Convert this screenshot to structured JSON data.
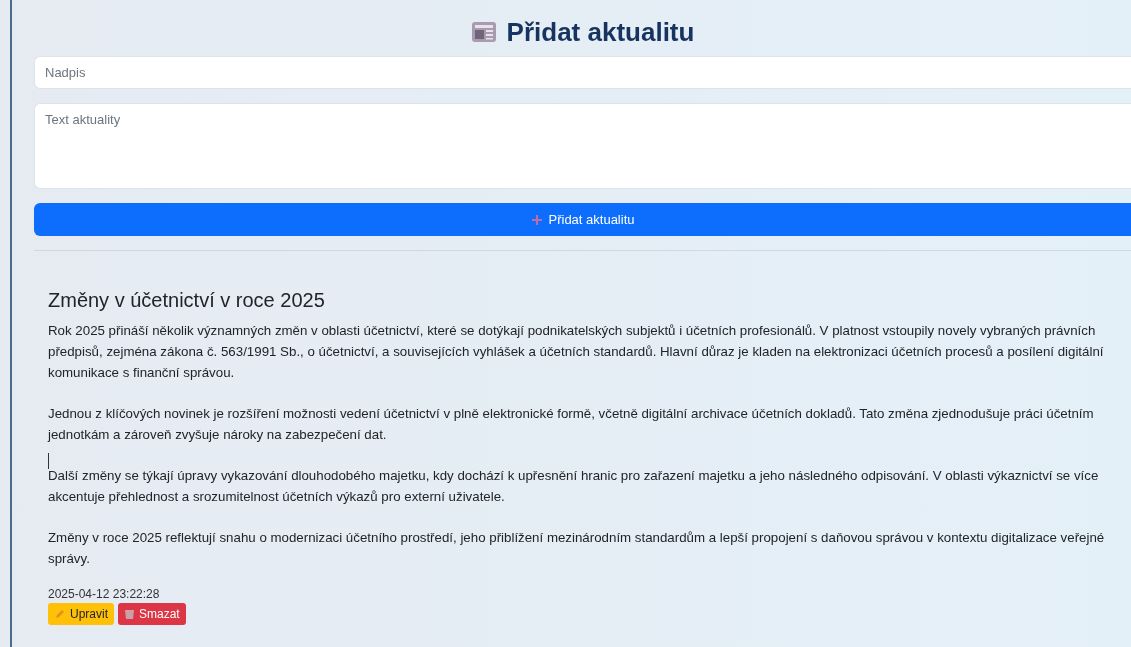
{
  "heading": "Přidat aktualitu",
  "form": {
    "title_placeholder": "Nadpis",
    "text_placeholder": "Text aktuality",
    "submit_label": "Přidat aktualitu"
  },
  "news": [
    {
      "title": "Změny v účetnictví v roce 2025",
      "paragraphs": [
        "Rok 2025 přináší několik významných změn v oblasti účetnictví, které se dotýkají podnikatelských subjektů i účetních profesionálů. V platnost vstoupily novely vybraných právních předpisů, zejména zákona č. 563/1991 Sb., o účetnictví, a souvisejících vyhlášek a účetních standardů. Hlavní důraz je kladen na elektronizaci účetních procesů a posílení digitální komunikace s finanční správou.",
        "Jednou z klíčových novinek je rozšíření možnosti vedení účetnictví v plně elektronické formě, včetně digitální archivace účetních dokladů. Tato změna zjednodušuje práci účetním jednotkám a zároveň zvyšuje nároky na zabezpečení dat.",
        "Další změny se týkají úpravy vykazování dlouhodobého majetku, kdy dochází k upřesnění hranic pro zařazení majetku a jeho následného odpisování. V oblasti výkaznictví se více akcentuje přehlednost a srozumitelnost účetních výkazů pro externí uživatele.",
        "Změny v roce 2025 reflektují snahu o modernizaci účetního prostředí, jeho přiblížení mezinárodním standardům a lepší propojení s daňovou správou v kontextu digitalizace veřejné správy."
      ],
      "timestamp": "2025-04-12 23:22:28",
      "edit_label": "Upravit",
      "delete_label": "Smazat"
    }
  ]
}
